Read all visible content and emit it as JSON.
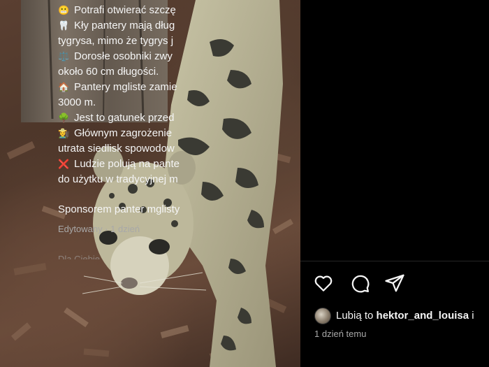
{
  "post": {
    "image_alt_subject": "clouded-leopard",
    "caption_lines": [
      {
        "emoji": "😬",
        "text": "Potrafi otwierać szczę"
      },
      {
        "emoji": "🦷",
        "text": "Kły pantery mają dług"
      },
      {
        "emoji": "",
        "text": "tygrysa, mimo że tygrys j"
      },
      {
        "emoji": "⚖️",
        "text": "Dorosłe osobniki zwy"
      },
      {
        "emoji": "",
        "text": "około 60 cm długości."
      },
      {
        "emoji": "🏠",
        "text": "Pantery mgliste zamie"
      },
      {
        "emoji": "",
        "text": "3000 m."
      },
      {
        "emoji": "🌳",
        "text": "Jest to gatunek przed"
      },
      {
        "emoji": "👩‍🌾",
        "text": "Głównym zagrożenie"
      },
      {
        "emoji": "",
        "text": "utrata siedlisk spowodow"
      },
      {
        "emoji": "❌",
        "text": "Ludzie polują na pante"
      },
      {
        "emoji": "",
        "text": "do użytku w tradycyjnej m"
      }
    ],
    "sponsor_text": "Sponsorem panter mglisty",
    "edited_text": "Edytowany · 1 dzień",
    "cutoff_text": "Dla Ciebie"
  },
  "actions": {
    "like_icon": "heart-icon",
    "comment_icon": "comment-icon",
    "share_icon": "share-icon"
  },
  "likes": {
    "prefix": "Lubią to ",
    "user": "hektor_and_louisa",
    "suffix": " i"
  },
  "time_ago": "1 dzień temu"
}
